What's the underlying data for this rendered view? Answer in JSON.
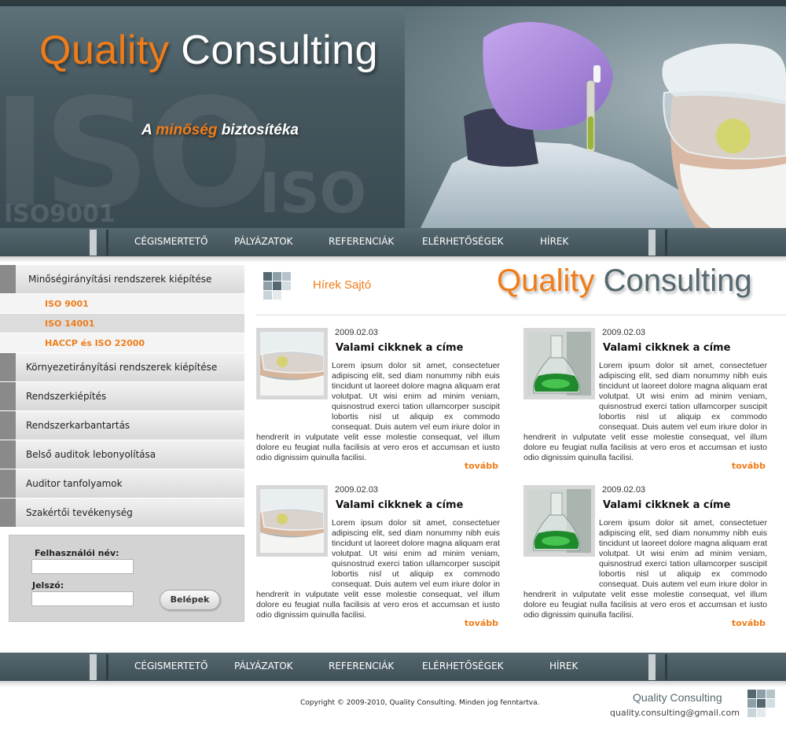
{
  "header": {
    "brand_q": "Quality",
    "brand_rest": " Consulting",
    "slogan_a": "A ",
    "slogan_em": "minőség",
    "slogan_b": " biztosítéka",
    "bg_iso_big": "ISO",
    "bg_iso_mid": "ISO",
    "bg_iso_small": "ISO9001"
  },
  "nav": {
    "items": [
      "CÉGISMERTETŐ",
      "PÁLYÁZATOK",
      "REFERENCIÁK",
      "ELÉRHETŐSÉGEK",
      "HÍREK"
    ]
  },
  "sidebar": {
    "items": [
      "Minőségirányítási rendszerek kiépítése",
      "Környezetirányítási rendszerek kiépítése",
      "Rendszerkiépítés",
      "Rendszerkarbantartás",
      "Belső auditok lebonyolítása",
      "Auditor tanfolyamok",
      "Szakértői tevékenység"
    ],
    "subitems": [
      "ISO 9001",
      "ISO 14001",
      "HACCP és ISO 22000"
    ]
  },
  "login": {
    "username_label": "Felhasználói név:",
    "username_value": "",
    "password_label": "Jelszó:",
    "password_value": "",
    "button": "Belépek"
  },
  "content": {
    "title": "Hírek Sajtó",
    "logo_q": "Quality",
    "logo_rest": " Consulting",
    "articles": [
      {
        "date": "2009.02.03",
        "title": "Valami cikknek a címe",
        "more": "tovább",
        "image": "lab-worker-photo",
        "body": "Lorem ipsum dolor sit amet, consectetuer adipiscing elit, sed diam nonummy nibh euis tincidunt ut laoreet dolore magna aliquam erat volutpat. Ut wisi enim ad minim veniam, quisnostrud exerci tation ullamcorper suscipit lobortis nisl ut aliquip ex commodo consequat. Duis autem vel eum iriure dolor in hendrerit in vulputate velit esse molestie consequat, vel illum dolore eu feugiat nulla facilisis at vero eros et accumsan et iusto odio dignissim quinulla facilisi."
      },
      {
        "date": "2009.02.03",
        "title": "Valami cikknek a címe",
        "more": "tovább",
        "image": "flask-photo",
        "body": "Lorem ipsum dolor sit amet, consectetuer adipiscing elit, sed diam nonummy nibh euis tincidunt ut laoreet dolore magna aliquam erat volutpat. Ut wisi enim ad minim veniam, quisnostrud exerci tation ullamcorper suscipit lobortis nisl ut aliquip ex commodo consequat. Duis autem vel eum iriure dolor in hendrerit in vulputate velit esse molestie consequat, vel illum dolore eu feugiat nulla facilisis at vero eros et accumsan et iusto odio dignissim quinulla facilisi."
      },
      {
        "date": "2009.02.03",
        "title": "Valami cikknek a címe",
        "more": "tovább",
        "image": "lab-worker-photo",
        "body": "Lorem ipsum dolor sit amet, consectetuer adipiscing elit, sed diam nonummy nibh euis tincidunt ut laoreet dolore magna aliquam erat volutpat. Ut wisi enim ad minim veniam, quisnostrud exerci tation ullamcorper suscipit lobortis nisl ut aliquip ex commodo consequat. Duis autem vel eum iriure dolor in hendrerit in vulputate velit esse molestie consequat, vel illum dolore eu feugiat nulla facilisis at vero eros et accumsan et iusto odio dignissim quinulla facilisi."
      },
      {
        "date": "2009.02.03",
        "title": "Valami cikknek a címe",
        "more": "tovább",
        "image": "flask-photo",
        "body": "Lorem ipsum dolor sit amet, consectetuer adipiscing elit, sed diam nonummy nibh euis tincidunt ut laoreet dolore magna aliquam erat volutpat. Ut wisi enim ad minim veniam, quisnostrud exerci tation ullamcorper suscipit lobortis nisl ut aliquip ex commodo consequat. Duis autem vel eum iriure dolor in hendrerit in vulputate velit esse molestie consequat, vel illum dolore eu feugiat nulla facilisis at vero eros et accumsan et iusto odio dignissim quinulla facilisi."
      }
    ]
  },
  "footer": {
    "copyright": "Copyright © 2009-2010, Quality Consulting. Minden jog fenntartva.",
    "company": "Quality Consulting",
    "email": "quality.consulting@gmail.com"
  },
  "colors": {
    "accent": "#f07c18",
    "nav_bg": "#46575e",
    "text_dark": "#56686f"
  }
}
